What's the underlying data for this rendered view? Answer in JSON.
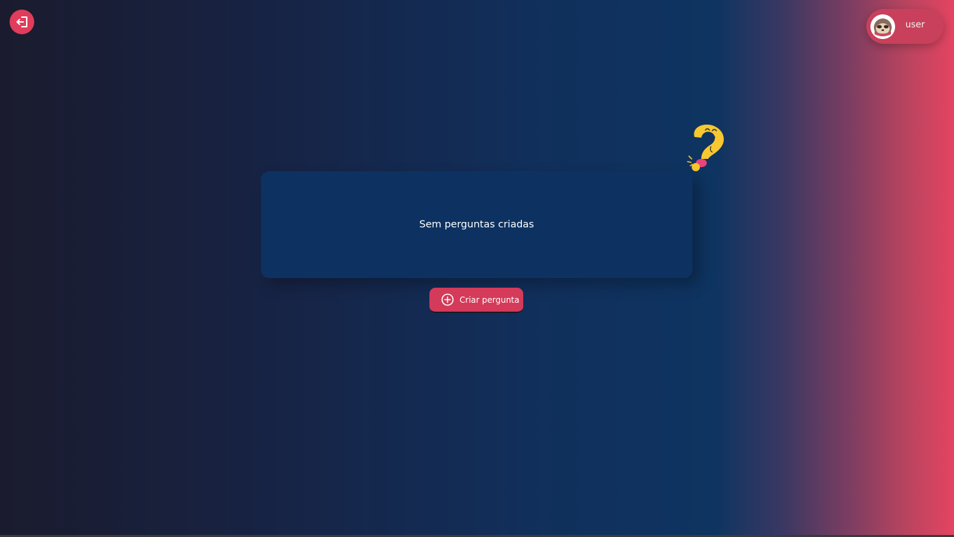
{
  "header": {
    "logout_icon": "logout-icon",
    "user": {
      "name": "user",
      "avatar_icon": "sloth-avatar-icon"
    }
  },
  "main": {
    "empty_message": "Sem perguntas criadas",
    "mascot_icon": "question-mark-mascot-icon",
    "create_button": {
      "label": "Criar pergunta",
      "icon": "plus-circle-icon"
    }
  },
  "colors": {
    "accent": "#e13c5b",
    "card": "#0d3261",
    "gradient_start": "#1a1b2e",
    "gradient_end": "#e44461"
  }
}
